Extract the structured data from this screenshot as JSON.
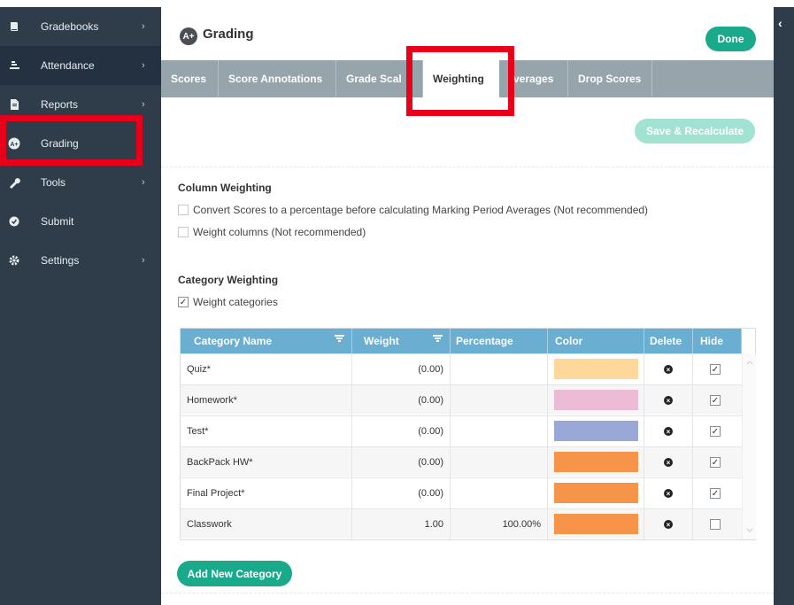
{
  "sidebar": {
    "items": [
      {
        "label": "Gradebooks",
        "icon": "book-icon",
        "has_chevron": true
      },
      {
        "label": "Attendance",
        "icon": "person-desk-icon",
        "has_chevron": true
      },
      {
        "label": "Reports",
        "icon": "document-icon",
        "has_chevron": true
      },
      {
        "label": "Grading",
        "icon": "a-plus-icon",
        "has_chevron": false
      },
      {
        "label": "Tools",
        "icon": "wrench-icon",
        "has_chevron": true
      },
      {
        "label": "Submit",
        "icon": "check-circle-icon",
        "has_chevron": false
      },
      {
        "label": "Settings",
        "icon": "gear-icon",
        "has_chevron": true
      }
    ]
  },
  "header": {
    "logo_text": "A+",
    "title": "Grading",
    "done_label": "Done"
  },
  "tabs": [
    {
      "label": "Scores"
    },
    {
      "label": "Score Annotations"
    },
    {
      "label": "Grade Scal"
    },
    {
      "label": "Weighting",
      "active": true
    },
    {
      "label": "verages"
    },
    {
      "label": "Drop Scores"
    }
  ],
  "actions": {
    "save_label": "Save & Recalculate",
    "add_label": "Add New Category"
  },
  "column_weighting": {
    "title": "Column Weighting",
    "options": [
      {
        "label": "Convert Scores to a percentage before calculating Marking Period Averages (Not recommended)",
        "checked": false
      },
      {
        "label": "Weight columns (Not recommended)",
        "checked": false
      }
    ]
  },
  "category_weighting": {
    "title": "Category Weighting",
    "weight_categories_label": "Weight categories",
    "weight_categories_checked": true
  },
  "table": {
    "headers": {
      "name": "Category Name",
      "weight": "Weight",
      "percentage": "Percentage",
      "color": "Color",
      "delete": "Delete",
      "hide": "Hide"
    },
    "rows": [
      {
        "name": "Quiz*",
        "weight": "(0.00)",
        "percentage": "",
        "color": "#fdd89a",
        "hidden": true
      },
      {
        "name": "Homework*",
        "weight": "(0.00)",
        "percentage": "",
        "color": "#ecbcd6",
        "hidden": true
      },
      {
        "name": "Test*",
        "weight": "(0.00)",
        "percentage": "",
        "color": "#9aa8d8",
        "hidden": true
      },
      {
        "name": "BackPack HW*",
        "weight": "(0.00)",
        "percentage": "",
        "color": "#f6954a",
        "hidden": true
      },
      {
        "name": "Final Project*",
        "weight": "(0.00)",
        "percentage": "",
        "color": "#f6954a",
        "hidden": true
      },
      {
        "name": "Classwork",
        "weight": "1.00",
        "percentage": "100.00%",
        "color": "#f6954a",
        "hidden": false
      }
    ]
  },
  "colors": {
    "sidebar_bg": "#2f3d4a",
    "accent_green": "#1aa98b",
    "tab_bar": "#96a4ac",
    "table_header": "#6aaed1",
    "highlight_red": "#e8001b"
  }
}
